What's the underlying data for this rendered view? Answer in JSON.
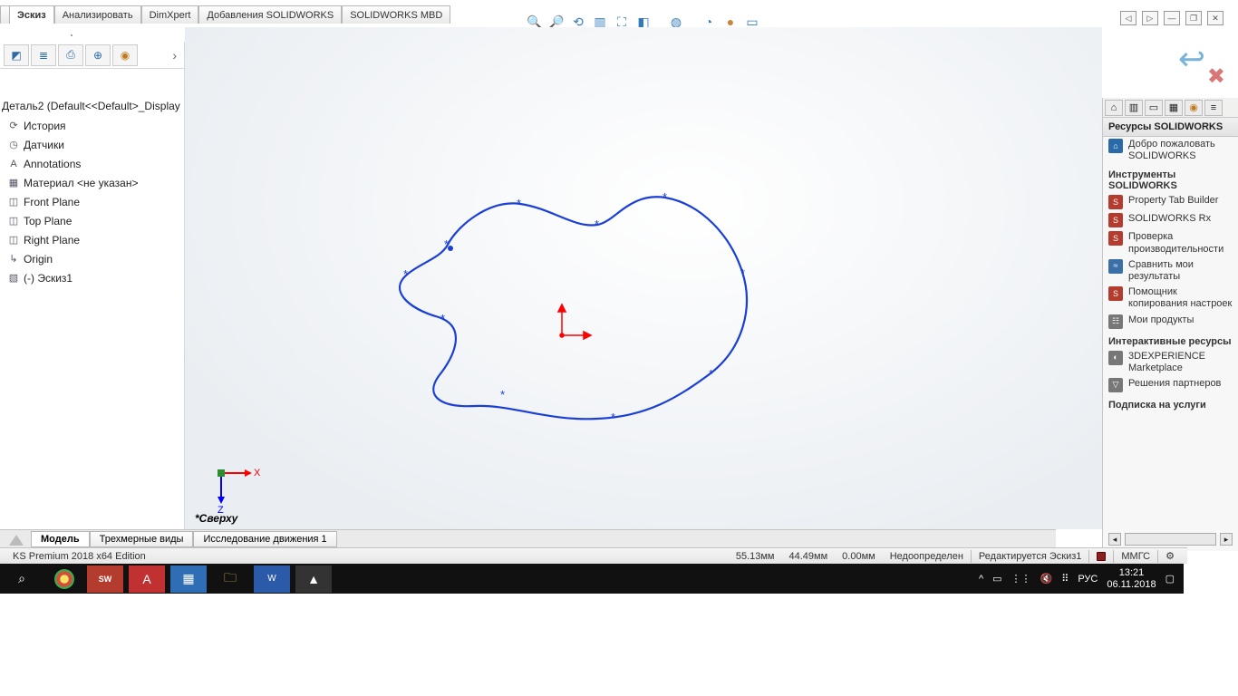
{
  "ribbon": {
    "tabs": [
      "Эскиз",
      "Анализировать",
      "DimXpert",
      "Добавления SOLIDWORKS",
      "SOLIDWORKS MBD"
    ]
  },
  "tree": {
    "title": "Деталь2  (Default<<Default>_Display",
    "items": [
      {
        "icon": "⟳",
        "label": "История"
      },
      {
        "icon": "◷",
        "label": "Датчики"
      },
      {
        "icon": "A",
        "label": "Annotations"
      },
      {
        "icon": "▦",
        "label": "Материал <не указан>"
      },
      {
        "icon": "◫",
        "label": "Front Plane"
      },
      {
        "icon": "◫",
        "label": "Top Plane"
      },
      {
        "icon": "◫",
        "label": "Right Plane"
      },
      {
        "icon": "↳",
        "label": "Origin"
      },
      {
        "icon": "▧",
        "label": "(-) Эскиз1"
      }
    ]
  },
  "viewport": {
    "triadX": "X",
    "triadZ": "Z",
    "plane": "*Сверху"
  },
  "resources": {
    "header": "Ресурсы SOLIDWORKS",
    "welcome": "Добро пожаловать SOLIDWORKS",
    "groups": [
      {
        "title": "Инструменты SOLIDWORKS",
        "links": [
          {
            "icon": "red",
            "label": "Property Tab Builder"
          },
          {
            "icon": "red",
            "label": "SOLIDWORKS Rx"
          },
          {
            "icon": "red",
            "label": "Проверка производительности"
          },
          {
            "icon": "blue",
            "label": "Сравнить мои результаты"
          },
          {
            "icon": "red",
            "label": "Помощник копирования настроек"
          },
          {
            "icon": "gray",
            "label": "Мои продукты"
          }
        ]
      },
      {
        "title": "Интерактивные ресурсы",
        "links": [
          {
            "icon": "gray",
            "label": "3DEXPERIENCE Marketplace"
          },
          {
            "icon": "gray",
            "label": "Решения партнеров"
          }
        ]
      },
      {
        "title": "Подписка на услуги",
        "links": []
      }
    ]
  },
  "bottom_tabs": [
    "Модель",
    "Трехмерные виды",
    "Исследование движения 1"
  ],
  "status": {
    "edition": "KS Premium 2018 x64 Edition",
    "x": "55.13мм",
    "y": "44.49мм",
    "z": "0.00мм",
    "defined": "Недоопределен",
    "editing": "Редактируется Эскиз1",
    "units": "ММГС"
  },
  "tray": {
    "lang": "РУС",
    "time": "13:21",
    "date": "06.11.2018"
  }
}
